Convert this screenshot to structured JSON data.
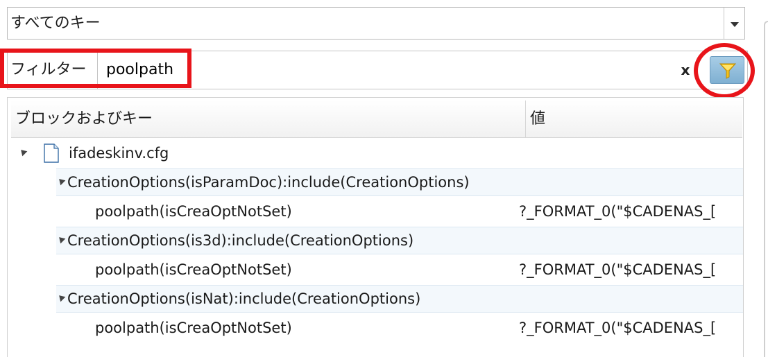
{
  "key_select": {
    "value": "すべてのキー"
  },
  "filter": {
    "label": "フィルター",
    "value": "poolpath",
    "clear_label": "x"
  },
  "table": {
    "columns": [
      "ブロックおよびキー",
      "値"
    ],
    "file": {
      "name": "ifadeskinv.cfg"
    },
    "groups": [
      {
        "label": "CreationOptions(isParamDoc):include(CreationOptions)",
        "key": "poolpath(isCreaOptNotSet)",
        "value": "?_FORMAT_0(\"$CADENAS_["
      },
      {
        "label": "CreationOptions(is3d):include(CreationOptions)",
        "key": "poolpath(isCreaOptNotSet)",
        "value": "?_FORMAT_0(\"$CADENAS_["
      },
      {
        "label": "CreationOptions(isNat):include(CreationOptions)",
        "key": "poolpath(isCreaOptNotSet)",
        "value": "?_FORMAT_0(\"$CADENAS_["
      }
    ]
  },
  "colors": {
    "highlight": "#e8141a",
    "filter_button": "#8fbedd",
    "row_band": "#f3f8fc"
  },
  "icons": [
    "chevron-down-icon",
    "filter-funnel-icon",
    "file-icon",
    "expand-triangle-icon"
  ]
}
